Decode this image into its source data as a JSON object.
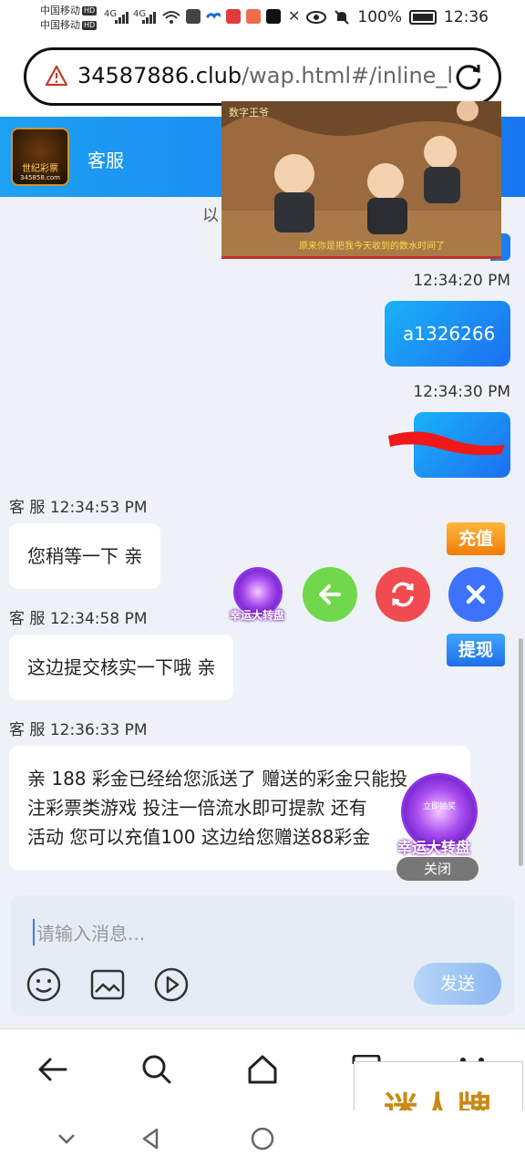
{
  "status_bar": {
    "carrier_1": "中国移动",
    "carrier_2": "中国移动",
    "hd": "HD",
    "network": "4G",
    "battery": "100%",
    "time": "12:36"
  },
  "browser": {
    "url_domain": "34587886.club",
    "url_path": "/wap.html#/inline_l"
  },
  "chat": {
    "title": "客服",
    "logo_text": "世纪彩票",
    "logo_sub": "345858.com",
    "partial_text": "以",
    "messages": [
      {
        "side": "right",
        "time": "12:34:20 PM",
        "text": "a1326266"
      },
      {
        "side": "right",
        "time": "12:34:30 PM",
        "text": ""
      },
      {
        "side": "left",
        "sender": "客 服",
        "time": "12:34:53 PM",
        "text": "您稍等一下 亲"
      },
      {
        "side": "left",
        "sender": "客 服",
        "time": "12:34:58 PM",
        "text": "这边提交核实一下哦 亲"
      },
      {
        "side": "left",
        "sender": "客 服",
        "time": "12:36:33 PM",
        "lines": [
          "亲 188 彩金已经给您派送了 赠送的彩金只能投",
          "注彩票类游戏 投注一倍流水即可提款 还有",
          "活动 您可以充值100 这边给您赠送88彩金"
        ]
      }
    ]
  },
  "video_overlay": {
    "title": "数字王爷",
    "subtitle": "原来你是把我今天收到的数水时间了"
  },
  "floating": {
    "recharge": "充值",
    "withdraw": "提现",
    "wheel_small_label": "幸运大转盘",
    "wheel_large_label": "幸运大转盘",
    "wheel_center": "立即抽奖",
    "wheel_close": "关闭"
  },
  "input": {
    "placeholder": "请输入消息...",
    "send": "发送"
  },
  "watermark": "迷人牌",
  "colors": {
    "header_start": "#1da1f2",
    "header_end": "#1876f2",
    "bubble_out": "#1c6ff2",
    "accent": "#3d72ff"
  }
}
